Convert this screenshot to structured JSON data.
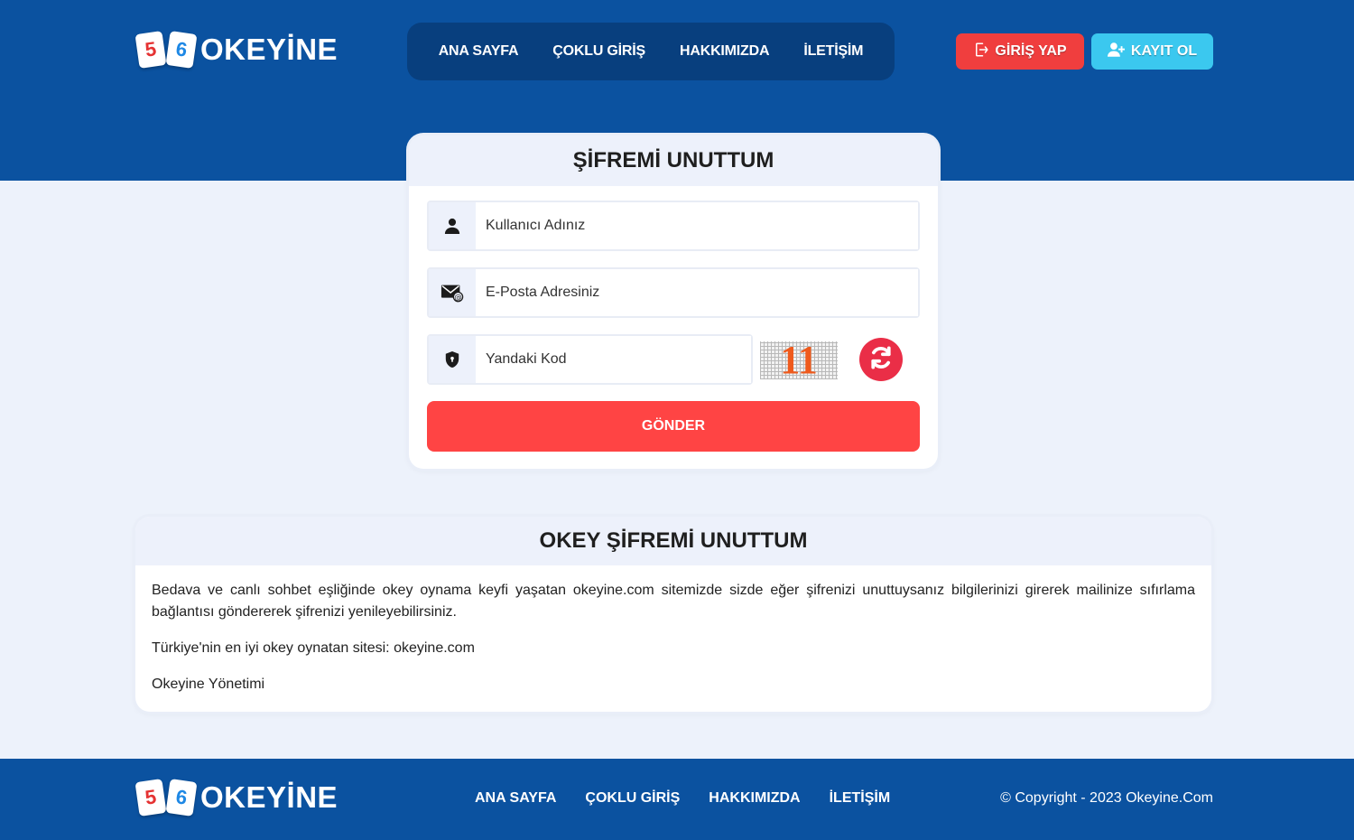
{
  "brand": {
    "tile_left": "5",
    "tile_right": "6",
    "name": "OKEYİNE"
  },
  "nav": [
    "ANA SAYFA",
    "ÇOKLU GİRİŞ",
    "HAKKIMIZDA",
    "İLETİŞİM"
  ],
  "header_buttons": {
    "login": "GİRİŞ YAP",
    "register": "KAYIT OL"
  },
  "form": {
    "title": "ŞİFREMİ UNUTTUM",
    "username_placeholder": "Kullanıcı Adınız",
    "email_placeholder": "E-Posta Adresiniz",
    "code_placeholder": "Yandaki Kod",
    "captcha_code": "11",
    "submit_label": "GÖNDER"
  },
  "info": {
    "title": "OKEY ŞİFREMİ UNUTTUM",
    "paragraphs": [
      "Bedava ve canlı sohbet eşliğinde okey oynama keyfi yaşatan okeyine.com sitemizde sizde eğer şifrenizi unuttuysanız bilgilerinizi girerek mailinize sıfırlama bağlantısı göndererek şifrenizi yenileyebilirsiniz.",
      "Türkiye'nin en iyi okey oynatan sitesi: okeyine.com",
      "Okeyine Yönetimi"
    ]
  },
  "footer": {
    "nav": [
      "ANA SAYFA",
      "ÇOKLU GİRİŞ",
      "HAKKIMIZDA",
      "İLETİŞİM"
    ],
    "copyright": "© Copyright - 2023 Okeyine.Com"
  },
  "icons": [
    "user-icon",
    "envelope-icon",
    "shield-icon",
    "refresh-icon",
    "login-icon",
    "add-user-icon"
  ],
  "colors": {
    "header_bg": "#0b52a0",
    "nav_box_bg": "#083f7e",
    "login_button": "#f03e3e",
    "register_button": "#3bc8ef",
    "submit_button": "#ff4444",
    "refresh_button": "#ea2e47",
    "page_bg": "#edf2fb"
  }
}
